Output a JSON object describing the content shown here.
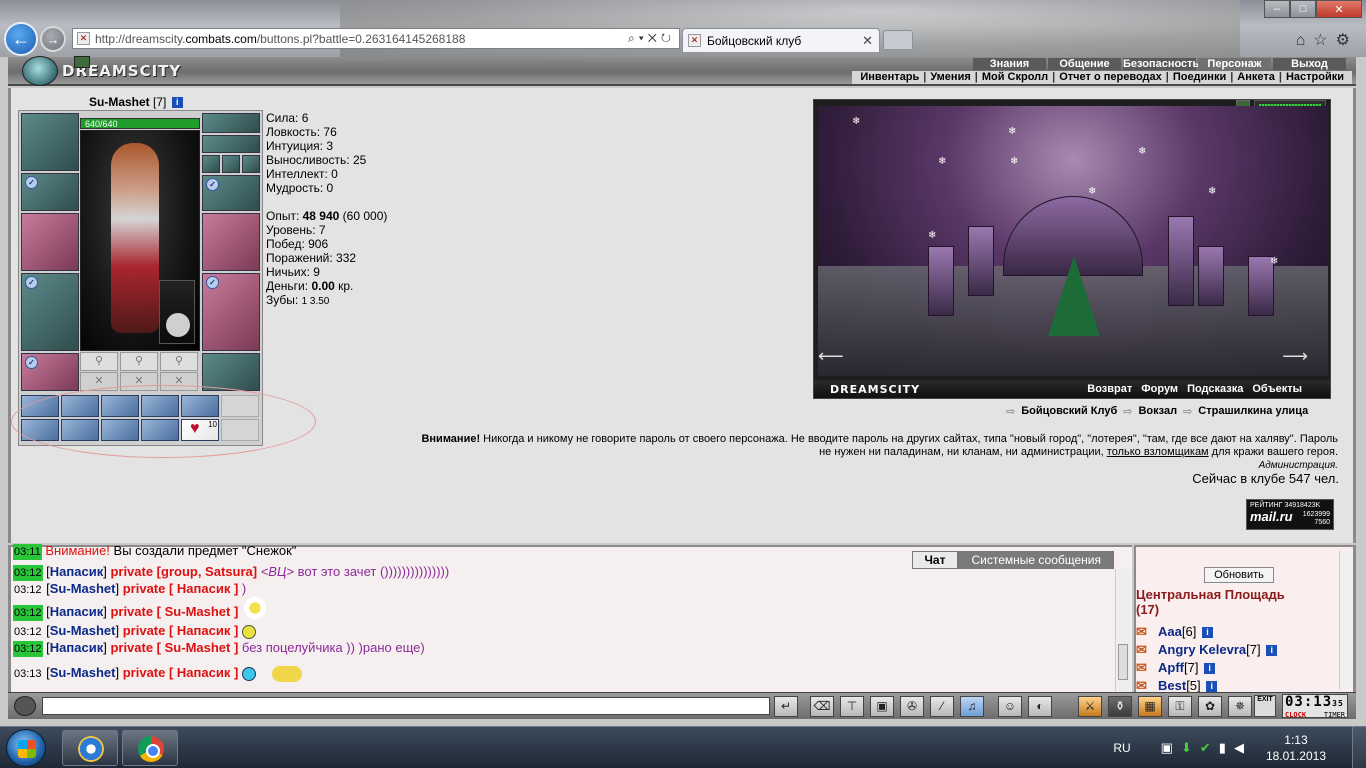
{
  "browser": {
    "url_prefix": "http://dreamscity.",
    "url_host": "combats.com",
    "url_rest": "/buttons.pl?battle=0.263164145268188",
    "tab_title": "Бойцовский клуб"
  },
  "site": {
    "logo": "DREAMSCITY",
    "top_menu": [
      "Знания",
      "Общение",
      "Безопасность",
      "Персонаж",
      "Выход"
    ],
    "sub_menu": [
      "Инвентарь",
      "Умения",
      "Мой Скролл",
      "Отчет о переводах",
      "Поединки",
      "Анкета",
      "Настройки"
    ]
  },
  "character": {
    "name": "Su-Mashet",
    "level": "[7]",
    "hp": "640/640",
    "info_icon": "i",
    "scroll_count": "10",
    "stats": {
      "strength": "Сила: 6",
      "agility": "Ловкость: 76",
      "intuition": "Интуиция: 3",
      "endurance": "Выносливость: 25",
      "intellect": "Интеллект: 0",
      "wisdom": "Мудрость: 0"
    },
    "exp_label": "Опыт: ",
    "exp_value": "48 940",
    "exp_next": " (60 000)",
    "level_line": "Уровень: 7",
    "wins": "Побед: 906",
    "losses": "Поражений: 332",
    "draws": "Ничьих: 9",
    "money_label": "Деньги: ",
    "money_value": "0.00",
    "money_unit": " кр.",
    "teeth_label": "Зубы: ",
    "teeth_value": "1 3.50"
  },
  "scene": {
    "logo": "DREAMSCITY",
    "links": [
      "Возврат",
      "Форум",
      "Подсказка",
      "Объекты"
    ]
  },
  "locations": [
    "Бойцовский Клуб",
    "Вокзал",
    "Страшилкина улица"
  ],
  "warning": {
    "bold": "Внимание!",
    "text1": " Никогда и никому не говорите пароль от своего персонажа. Не вводите пароль на других сайтах, типа \"новый город\", \"лотерея\", \"там, где все дают на халяву\". Пароль не нужен ни паладинам, ни кланам, ни администрации, ",
    "link": "только взломщикам",
    "text2": " для кражи вашего героя.",
    "admin": "Администрация."
  },
  "online": "Сейчас в клубе 547 чел.",
  "rating": {
    "label": "РЕЙТИНГ 34918423K",
    "mail": "mail.ru",
    "num1": "1623999",
    "num2": "7560"
  },
  "chat": {
    "tabs": [
      "Чат",
      "Системные сообщения"
    ],
    "lines": [
      {
        "time": "03:11",
        "a": "Внимание!",
        "b": " Вы создали предмет \"Снежок\""
      },
      {
        "time": "03:12",
        "nick": "Напасик",
        "priv": " private [group, Satsura] ",
        "tag": "<ВЦ>",
        "msg": " вот это зачет ()))))))))))))))"
      },
      {
        "time": "03:12",
        "nick": "Su-Mashet",
        "priv": " private [ Напасик ] ",
        "msg": ")"
      },
      {
        "time": "03:12",
        "nick": "Напасик",
        "priv": " private [ Su-Mashet ] ",
        "msg": ""
      },
      {
        "time": "03:12",
        "nick": "Su-Mashet",
        "priv": " private [ Напасик ] ",
        "msg": ""
      },
      {
        "time": "03:12",
        "nick": "Напасик",
        "priv": " private [ Su-Mashet ] ",
        "msg": "без поцелуйчика )) )рано еще)"
      },
      {
        "time": "03:13",
        "nick": "Su-Mashet",
        "priv": " private [ Напасик ] ",
        "msg": ""
      }
    ]
  },
  "users": {
    "refresh": "Обновить",
    "place": "Центральная Площадь",
    "count": "(17)",
    "list": [
      {
        "name": "Aaa",
        "lvl": "[6]"
      },
      {
        "name": "Angry Kelevra",
        "lvl": "[7]"
      },
      {
        "name": "Apff",
        "lvl": "[7]"
      },
      {
        "name": "Best",
        "lvl": "[5]"
      }
    ]
  },
  "clock": {
    "time": "03:13",
    "sec": "35",
    "label1": "CLOCK",
    "label2": "TIMER",
    "exit": "EXIT"
  },
  "taskbar": {
    "lang": "RU",
    "time": "1:13",
    "date": "18.01.2013"
  }
}
